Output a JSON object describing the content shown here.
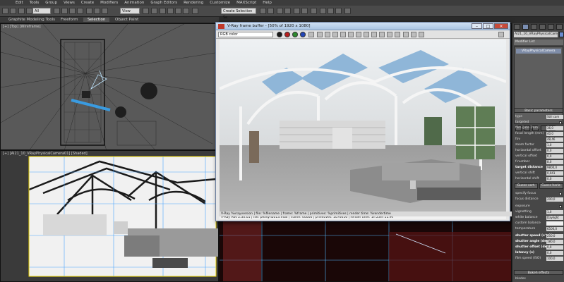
{
  "menu": {
    "items": [
      "Edit",
      "Tools",
      "Group",
      "Views",
      "Create",
      "Modifiers",
      "Animation",
      "Graph Editors",
      "Rendering",
      "Customize",
      "MAXScript",
      "Help"
    ]
  },
  "toolbar": {
    "selection_filter": "All",
    "reference_coord": "View",
    "named_selection": "Create Selection Se"
  },
  "ribbon": {
    "tabs": [
      "Graphite Modeling Tools",
      "Freeform",
      "Selection",
      "Object Paint"
    ],
    "active_tab": "Selection"
  },
  "viewports": {
    "top_label": "[+] [Top] [Wireframe]",
    "persp_label": "[+] [AI21_10_VRayPhysicalCamera01] [Shaded]"
  },
  "frame_buffer": {
    "title": "V-Ray frame buffer - [50% of 1920 x 1080]",
    "channel": "RGB color",
    "status": "V-Ray Adv 2.30.01 | file: pexsyn2013.max | frame: 00000 | primitives: 1076016 | render time: 1h 23m 11.9s",
    "stamp": "V-Ray %vrayversion | file: %filename | frame: %frame | primitives: %primitives | render time: %rendertime",
    "dot_colors": [
      "#1a1a1a",
      "#b81e1e",
      "#2e8b2e",
      "#2346b8"
    ]
  },
  "command_panel": {
    "object_name": "AI21_10_VRayPhysicalCamer",
    "modifier_list": "Modifier List",
    "stack_item": "VRayPhysicalCamera",
    "rollout_basic": "Basic parameters",
    "params": [
      {
        "label": "type",
        "value": "Still cam"
      },
      {
        "label": "targeted",
        "check": true
      },
      {
        "label": "film gate (mm)",
        "value": "36,0"
      },
      {
        "label": "focal length (mm)",
        "value": "40,0"
      },
      {
        "label": "fov",
        "value": "48,46"
      },
      {
        "label": "zoom factor",
        "value": "1,0"
      },
      {
        "label": "horizontal offset",
        "value": "0,0"
      },
      {
        "label": "vertical offset",
        "value": "0,0"
      },
      {
        "label": "f-number",
        "value": "8,0"
      },
      {
        "label": "target distance",
        "value": "9800,0"
      },
      {
        "label": "vertical shift",
        "value": "0,041"
      },
      {
        "label": "horizontal shift",
        "value": "0,0"
      }
    ],
    "guess_vert": "Guess vert.",
    "guess_horiz": "Guess horiz.",
    "params2": [
      {
        "label": "specify focus",
        "check": false
      },
      {
        "label": "focus distance",
        "value": "200,0"
      },
      {
        "label": "exposure",
        "check": true
      },
      {
        "label": "vignetting",
        "value": "1,0"
      },
      {
        "label": "white balance",
        "value": "Daylight"
      },
      {
        "label": "custom balance",
        "value": ""
      },
      {
        "label": "temperature",
        "value": "6500,0"
      },
      {
        "label": "shutter speed (s^-1)",
        "value": "250,0"
      },
      {
        "label": "shutter angle (deg)",
        "value": "180,0"
      },
      {
        "label": "shutter offset (deg)",
        "value": "0,0"
      },
      {
        "label": "latency (s)",
        "value": "0,0"
      },
      {
        "label": "film speed (ISO)",
        "value": "100,0"
      }
    ],
    "rollout_bokeh": "Bokeh effects",
    "blades_label": "blades"
  }
}
